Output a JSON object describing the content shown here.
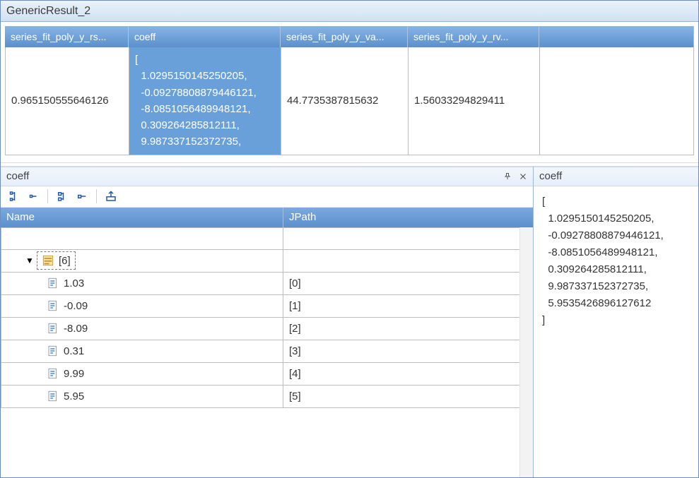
{
  "top": {
    "title": "GenericResult_2",
    "columns": [
      "series_fit_poly_y_rs...",
      "coeff",
      "series_fit_poly_y_va...",
      "series_fit_poly_y_rv..."
    ],
    "row": {
      "c1": "0.965150555646126",
      "coeff_lines": "[\n  1.0295150145250205,\n  -0.09278808879446121,\n  -8.0851056489948121,\n  0.309264285812111,\n  9.987337152372735,",
      "c3": "44.7735387815632",
      "c4": "1.56033294829411"
    }
  },
  "left": {
    "title": "coeff",
    "headers": [
      "Name",
      "JPath"
    ],
    "root_label": "[6]",
    "items": [
      {
        "val": "1.03",
        "jpath": "[0]"
      },
      {
        "val": "-0.09",
        "jpath": "[1]"
      },
      {
        "val": "-8.09",
        "jpath": "[2]"
      },
      {
        "val": "0.31",
        "jpath": "[3]"
      },
      {
        "val": "9.99",
        "jpath": "[4]"
      },
      {
        "val": "5.95",
        "jpath": "[5]"
      }
    ]
  },
  "right": {
    "title": "coeff",
    "text": "[\n  1.0295150145250205,\n  -0.09278808879446121,\n  -8.0851056489948121,\n  0.309264285812111,\n  9.987337152372735,\n  5.9535426896127612\n]"
  }
}
